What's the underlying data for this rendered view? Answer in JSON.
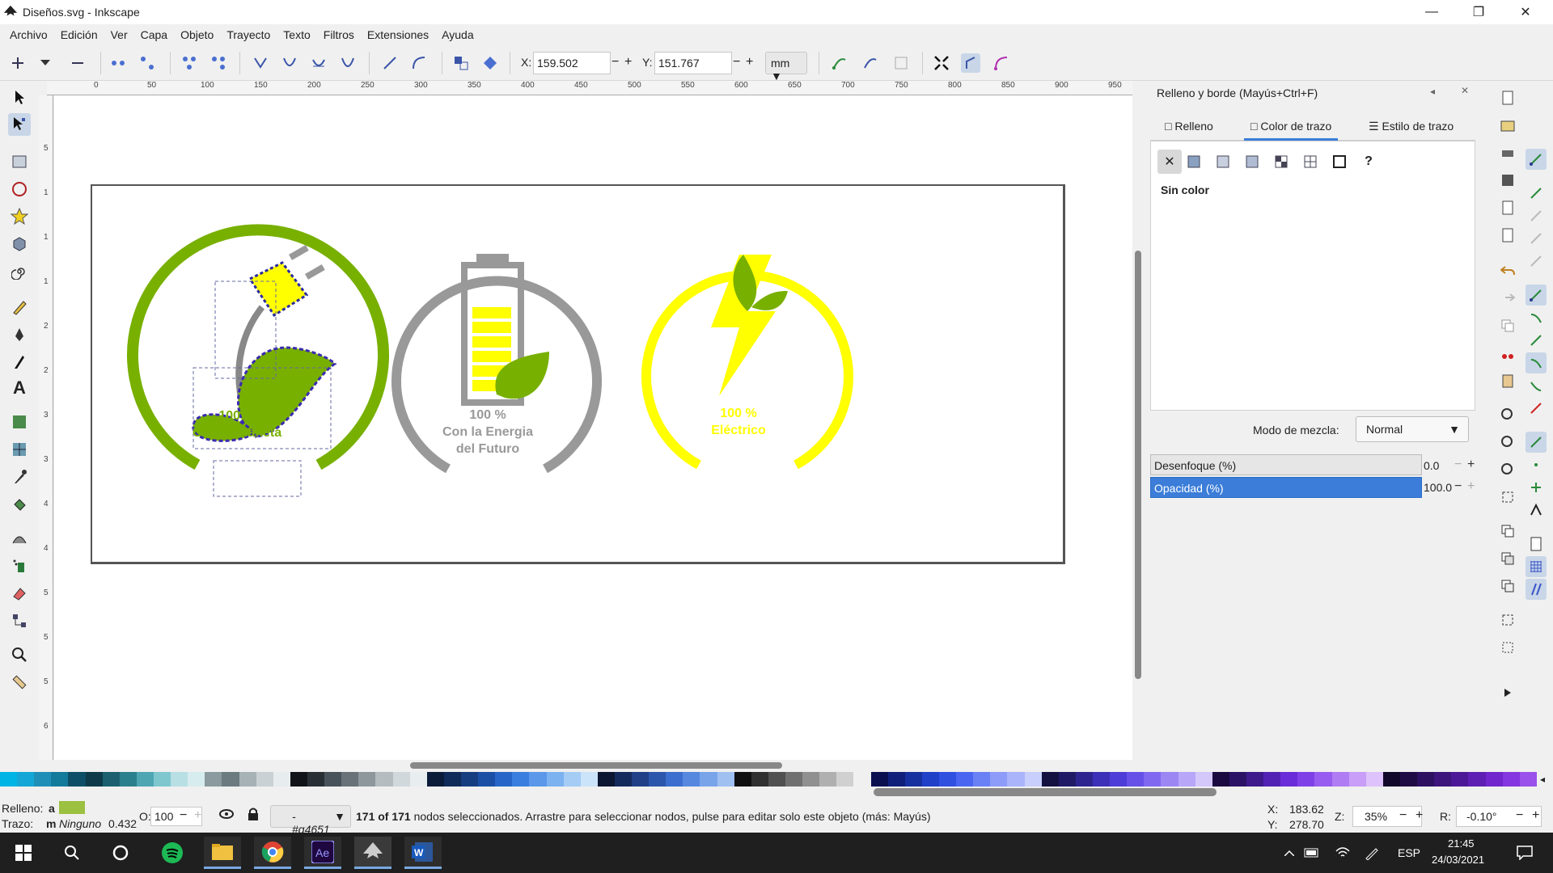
{
  "window": {
    "title": "Diseños.svg - Inkscape"
  },
  "menu": [
    "Archivo",
    "Edición",
    "Ver",
    "Capa",
    "Objeto",
    "Trayecto",
    "Texto",
    "Filtros",
    "Extensiones",
    "Ayuda"
  ],
  "toolbar": {
    "x_label": "X:",
    "x_value": "159.502",
    "y_label": "Y:",
    "y_value": "151.767",
    "units": "mm"
  },
  "ruler_top": [
    "0",
    "50",
    "100",
    "150",
    "200",
    "250",
    "300",
    "350",
    "400",
    "450",
    "500",
    "550",
    "600",
    "650",
    "700",
    "750",
    "800",
    "850",
    "900",
    "950"
  ],
  "ruler_left": [
    "5",
    "1",
    "1",
    "1",
    "2",
    "2",
    "3",
    "3",
    "4",
    "4",
    "5",
    "5",
    "5",
    "6",
    "6"
  ],
  "logos": [
    {
      "pct": "100 %",
      "line1": "Con el Planeta",
      "line2": "",
      "color": "#78b000"
    },
    {
      "pct": "100 %",
      "line1": "Con la Energia",
      "line2": "del Futuro",
      "color": "#999999"
    },
    {
      "pct": "100 %",
      "line1": "Eléctrico",
      "line2": "",
      "color": "#ffff00"
    }
  ],
  "dock": {
    "title": "Relleno y borde (Mayús+Ctrl+F)",
    "tabs": [
      "Relleno",
      "Color de trazo",
      "Estilo de trazo"
    ],
    "paint_status": "Sin color",
    "blend_label": "Modo de mezcla:",
    "blend_value": "Normal",
    "blur_label": "Desenfoque (%)",
    "blur_value": "0.0",
    "opacity_label": "Opacidad (%)",
    "opacity_value": "100.0",
    "unknown_glyph": "?"
  },
  "palette": [
    "#00b4e6",
    "#13a6d6",
    "#1f8fb8",
    "#127a9a",
    "#0e4e66",
    "#0e3a4a",
    "#1c6070",
    "#2a808c",
    "#4ea6b3",
    "#7ec7cf",
    "#b8dfe3",
    "#d7ecee",
    "#8a9a9e",
    "#6b7b80",
    "#a6b2b6",
    "#c9d1d4",
    "#e7ecee",
    "#101418",
    "#283036",
    "#48525a",
    "#687278",
    "#8e979c",
    "#b4bcc0",
    "#d0d8dc",
    "#e8edf0",
    "#0a1c3a",
    "#102b5a",
    "#163d80",
    "#1b4fa6",
    "#2766c8",
    "#3a7ee0",
    "#5b98ea",
    "#7cb2f0",
    "#a4ccf5",
    "#cce4fa",
    "#0b1630",
    "#152a5c",
    "#203f86",
    "#2c55ac",
    "#3b6ece",
    "#5788e0",
    "#7aa4ea",
    "#a0c0f2",
    "#101010",
    "#303030",
    "#505050",
    "#707070",
    "#909090",
    "#b0b0b0",
    "#d0d0d0",
    "#f0f0f0",
    "#0a0f50",
    "#10207a",
    "#1630a0",
    "#2040c8",
    "#3050e0",
    "#4a66f0",
    "#6a80f5",
    "#8c9cf8",
    "#aab4fa",
    "#c8cffc",
    "#141040",
    "#201a66",
    "#2e2490",
    "#3c30b8",
    "#4e3cd8",
    "#6650e8",
    "#8068f0",
    "#9c86f4",
    "#b8a6f8",
    "#d4c8fb",
    "#1a0a40",
    "#2c1266",
    "#3e1a8c",
    "#5222b4",
    "#6a2cd8",
    "#8040e8",
    "#985cf0",
    "#b07cf4",
    "#c89ef8",
    "#dec2fb",
    "#12082a",
    "#200c44",
    "#2e1060",
    "#3c147c",
    "#4c1898",
    "#5e1eb4",
    "#7026cc",
    "#8436e0",
    "#9a50ea"
  ],
  "status": {
    "fill_label": "Relleno:",
    "fill_value": "a",
    "fill_color": "#9cc040",
    "stroke_label": "Trazo:",
    "stroke_prefix": "m",
    "stroke_value": "Ninguno",
    "stroke_width": "0.432",
    "opacity_label": "O:",
    "opacity_value": "100",
    "layer": "-#g4651",
    "message_bold": "171 of 171",
    "message": " nodos seleccionados. Arrastre para seleccionar nodos, pulse para editar solo este objeto (más: Mayús)",
    "x_label": "X:",
    "x_value": "183.62",
    "y_label": "Y:",
    "y_value": "278.70",
    "zoom_label": "Z:",
    "zoom_value": "35%",
    "rot_label": "R:",
    "rot_value": "-0.10°"
  },
  "taskbar": {
    "lang": "ESP",
    "time": "21:45",
    "date": "24/03/2021"
  },
  "colors": {
    "green": "#78b000",
    "leaf": "#78b000",
    "gray": "#999999",
    "yellow": "#ffff00",
    "accent": "#3b7dd8"
  }
}
